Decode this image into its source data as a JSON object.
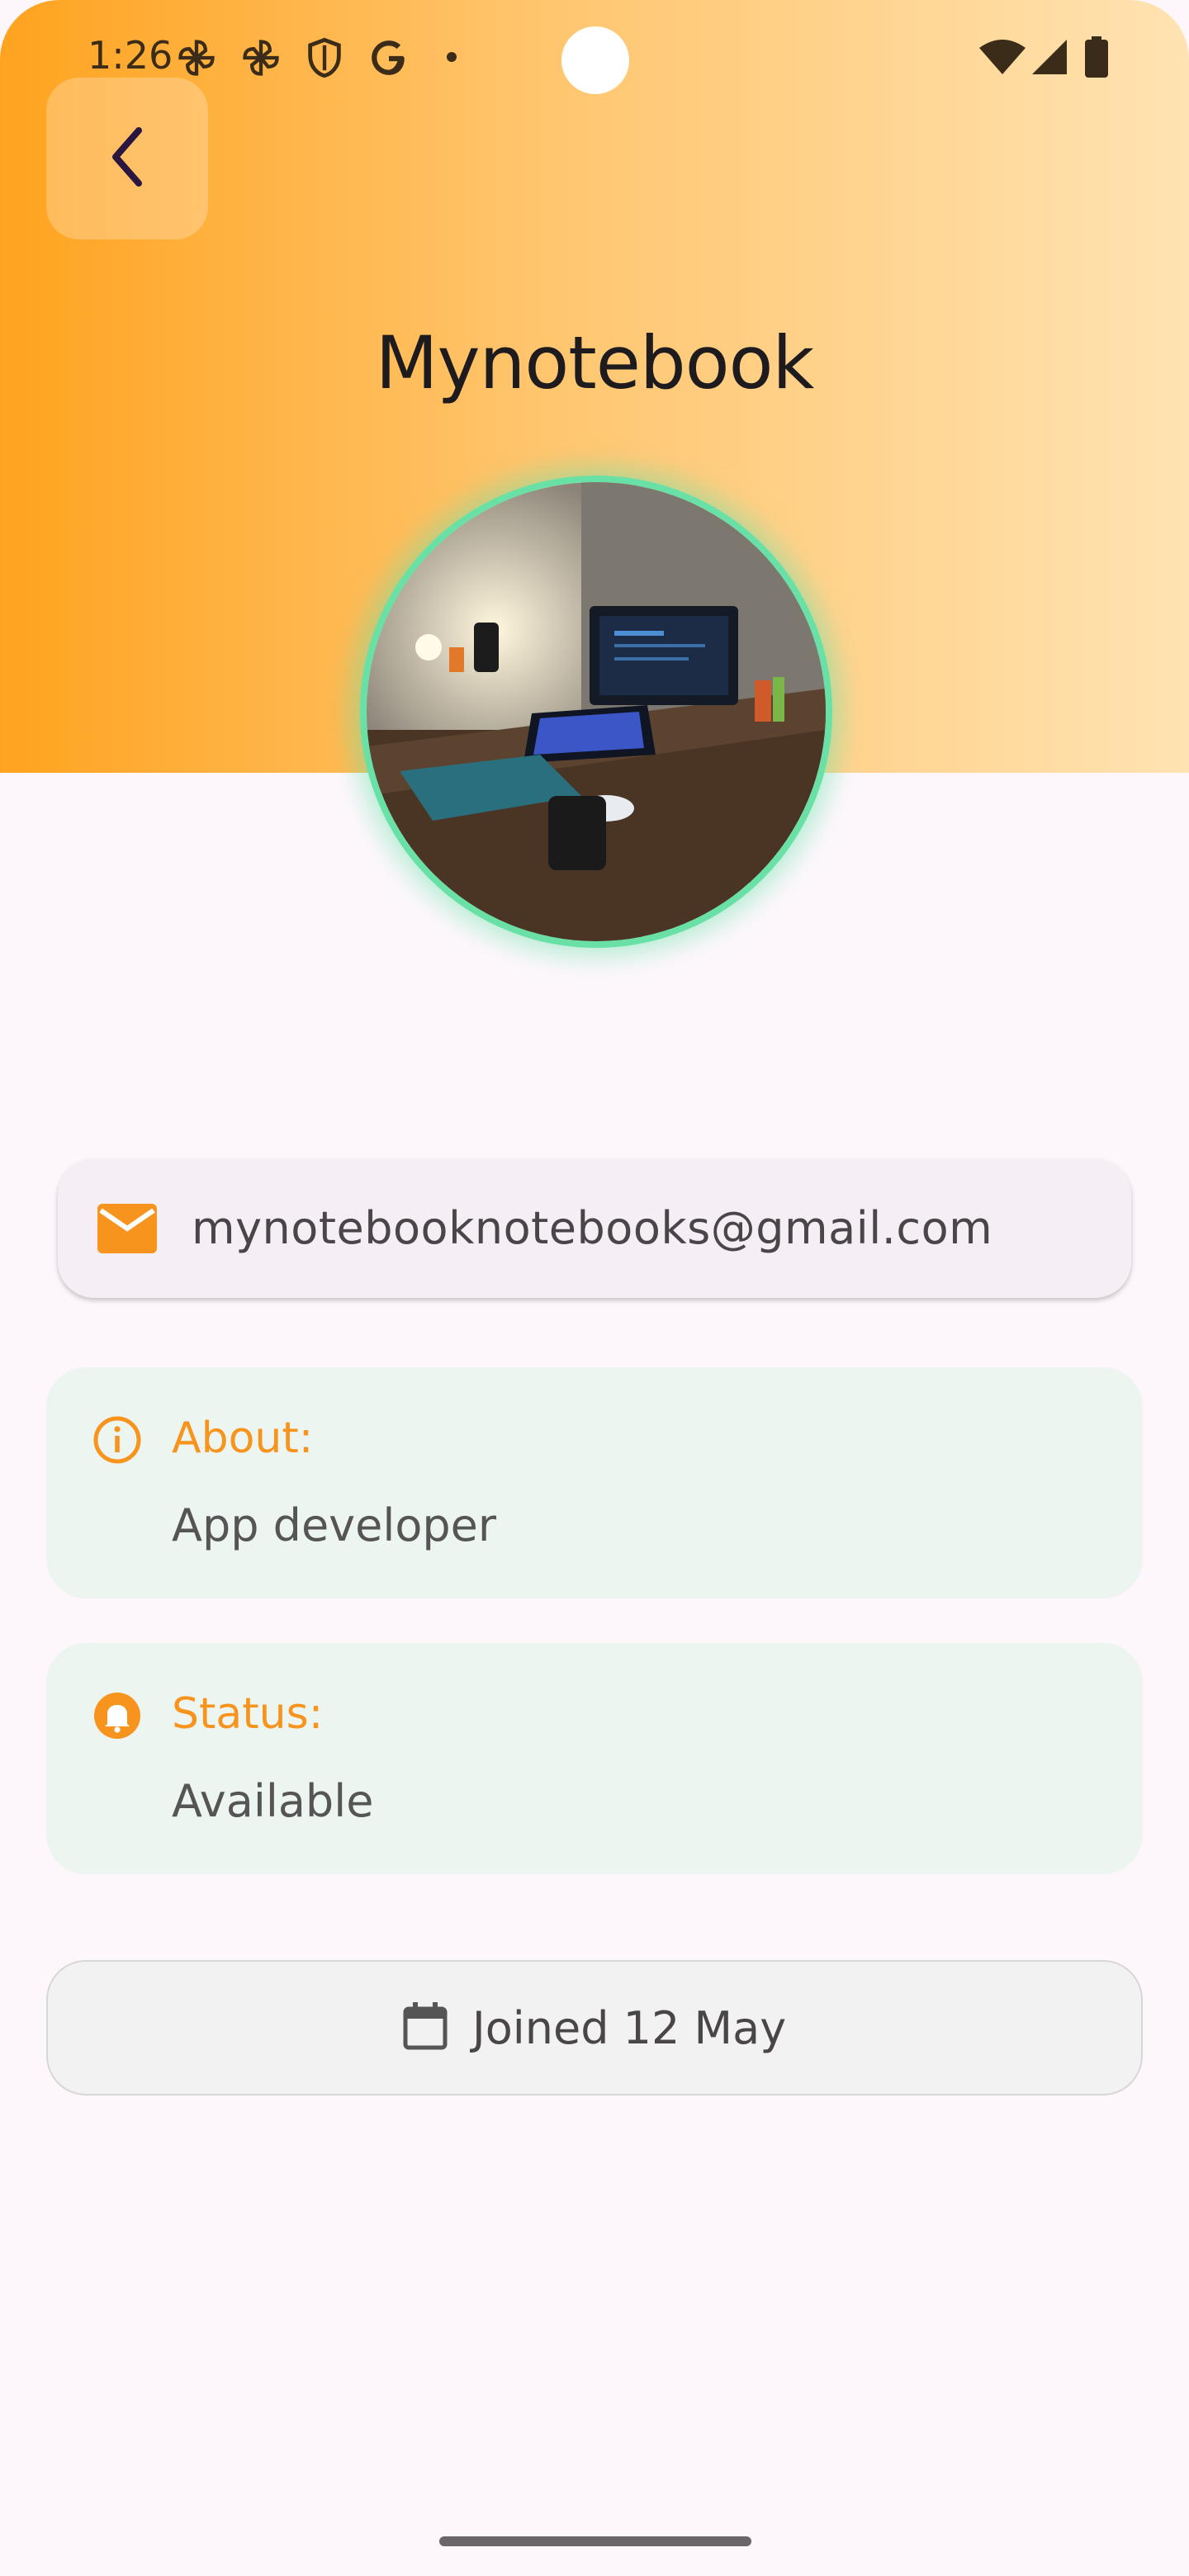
{
  "status_bar": {
    "time": "1:26",
    "left_icons": [
      "pinwheel-icon",
      "pinwheel-icon",
      "shield-icon",
      "google-icon",
      "dot-icon"
    ],
    "right_icons": [
      "wifi-icon",
      "cellular-icon",
      "battery-icon"
    ]
  },
  "header": {
    "title": "Mynotebook",
    "back_icon": "chevron-left-icon",
    "gradient": [
      "#ffa31f",
      "#ffe3b2"
    ]
  },
  "profile": {
    "avatar_ring_color": "#69e0a6"
  },
  "email": {
    "icon": "mail-icon",
    "value": "mynotebooknotebooks@gmail.com"
  },
  "about": {
    "icon": "info-icon",
    "label": "About:",
    "value": "App developer"
  },
  "status": {
    "icon": "bell-icon",
    "label": "Status:",
    "value": "Available"
  },
  "joined": {
    "icon": "calendar-icon",
    "text": "Joined 12 May"
  },
  "colors": {
    "accent": "#f7941d",
    "card_bg": "#edf5f1",
    "page_bg": "#fdf7fc"
  }
}
